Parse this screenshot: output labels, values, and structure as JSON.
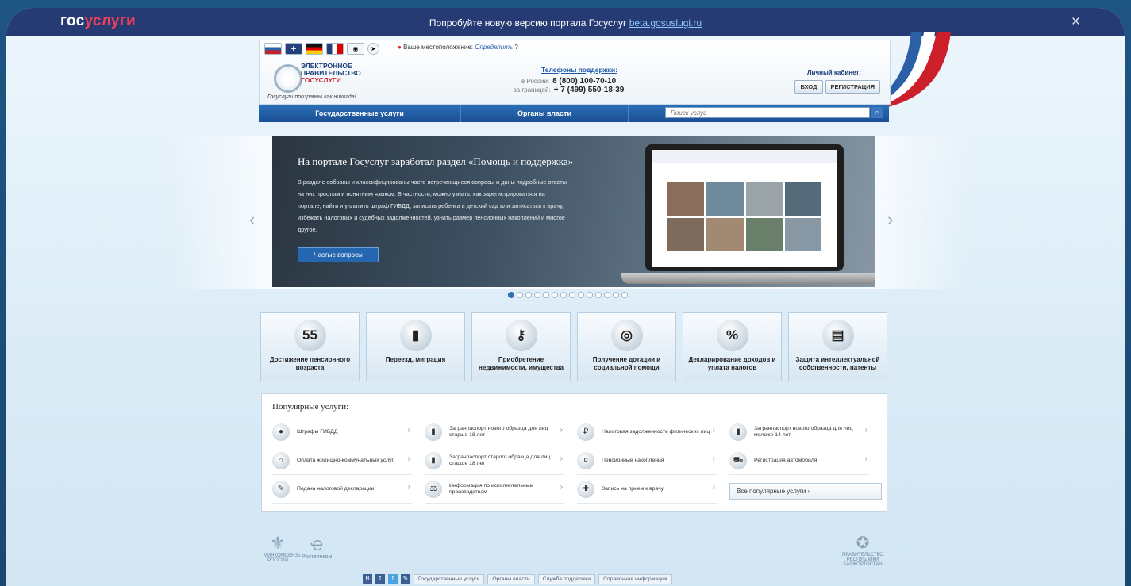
{
  "banner": {
    "logo_a": "гос",
    "logo_b": "услуги",
    "message": "Попробуйте новую версию портала Госуслуг ",
    "link": "beta.gosuslugi.ru",
    "close": "×"
  },
  "header": {
    "location_label": "Ваше местоположение:",
    "location_value": "Определить",
    "org_line1": "ЭЛЕКТРОННОЕ",
    "org_line2": "ПРАВИТЕЛЬСТВО",
    "org_line3": "ГОСУСЛУГИ",
    "slogan": "Госуслуги прозрачны как никогда!",
    "phones_title": "Телефоны поддержки:",
    "phone1_label": "в России:",
    "phone1": "8 (800) 100-70-10",
    "phone2_label": "за границей:",
    "phone2": "+ 7 (499) 550-18-39",
    "cabinet_title": "Личный кабинет:",
    "login": "ВХОД",
    "register": "РЕГИСТРАЦИЯ"
  },
  "nav": {
    "services": "Государственные услуги",
    "authorities": "Органы власти",
    "search_placeholder": "Поиск услуг"
  },
  "slide": {
    "title": "На портале Госуслуг заработал раздел «Помощь и поддержка»",
    "text": "В разделе собраны и классифицированы часто встречающиеся вопросы и даны подробные ответы на них простым и понятным языком. В частности, можно узнать, как зарегистрироваться на портале, найти и уплатить штраф ГИБДД, записать ребенка в детский сад или записаться к врачу, избежать налоговых и судебных задолженностей, узнать размер пенсионных накоплений и многое другое.",
    "button": "Частые вопросы",
    "total_slides": 14,
    "active_slide": 1
  },
  "categories": [
    {
      "label": "Достижение пенсионного возраста",
      "icon": "55"
    },
    {
      "label": "Переезд, миграция",
      "icon": "passport-icon"
    },
    {
      "label": "Приобретение недвижимости, имущества",
      "icon": "keys-icon"
    },
    {
      "label": "Получение дотации и социальной помощи",
      "icon": "lifebuoy-icon"
    },
    {
      "label": "Декларирование доходов и уплата налогов",
      "icon": "%"
    },
    {
      "label": "Защита интеллектуальной собственности, патенты",
      "icon": "certificate-icon"
    }
  ],
  "popular": {
    "title": "Популярные услуги:",
    "items": [
      {
        "label": "Штрафы ГИБДД",
        "icon": "traffic-light-icon"
      },
      {
        "label": "Загранпаспорт нового образца для лиц старше 18 лет",
        "icon": "passport-icon"
      },
      {
        "label": "Налоговая задолженность физических лиц",
        "icon": "tax-icon"
      },
      {
        "label": "Загранпаспорт нового образца для лиц моложе 14 лет",
        "icon": "passport-icon"
      },
      {
        "label": "Оплата жилищно-коммунальных услуг",
        "icon": "utilities-icon"
      },
      {
        "label": "Загранпаспорт старого образца для лиц старше 18 лет",
        "icon": "passport-icon"
      },
      {
        "label": "Пенсионные накопления",
        "icon": "pension-icon"
      },
      {
        "label": "Регистрация автомобиля",
        "icon": "car-icon"
      },
      {
        "label": "Подача налоговой декларации",
        "icon": "declaration-icon"
      },
      {
        "label": "Информация по исполнительным производствам",
        "icon": "scales-icon"
      },
      {
        "label": "Запись на прием к врачу",
        "icon": "doctor-icon"
      }
    ],
    "all_button": "Все популярные услуги"
  },
  "footer": {
    "left_logo1": "МИНКОМСВЯЗЬ РОССИИ",
    "left_logo2": "Ростелеком",
    "right_logo": "ПРАВИТЕЛЬСТВО РЕСПУБЛИКИ БАШКОРТОСТАН",
    "links": [
      "Государственные услуги",
      "Органы власти",
      "Служба поддержки",
      "Справочная информация"
    ]
  }
}
